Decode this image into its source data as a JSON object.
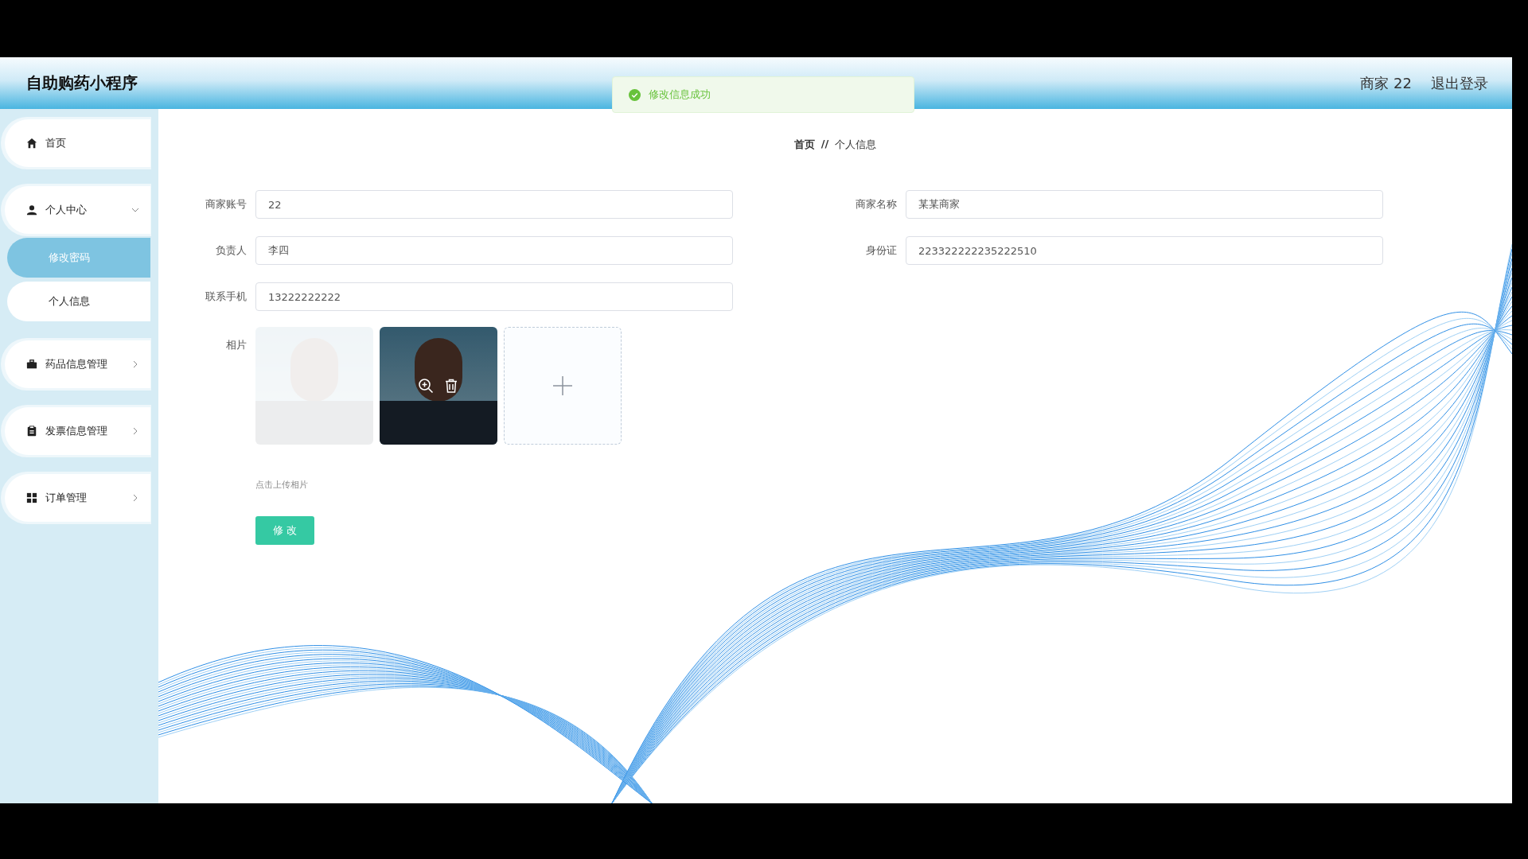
{
  "app": {
    "title": "自助购药小程序"
  },
  "header": {
    "user": "商家 22",
    "logout": "退出登录"
  },
  "toast": {
    "kind": "success",
    "message": "修改信息成功"
  },
  "sidebar": {
    "items": [
      {
        "label": "首页"
      },
      {
        "label": "个人中心",
        "expanded": true,
        "children": [
          {
            "label": "修改密码",
            "selected": true
          },
          {
            "label": "个人信息",
            "selected": false
          }
        ]
      },
      {
        "label": "药品信息管理",
        "expanded": false
      },
      {
        "label": "发票信息管理",
        "expanded": false
      },
      {
        "label": "订单管理",
        "expanded": false
      }
    ]
  },
  "breadcrumb": {
    "items": [
      "首页",
      "个人信息"
    ],
    "separator": "//"
  },
  "form": {
    "fields": [
      {
        "label": "商家账号",
        "value": "22"
      },
      {
        "label": "商家名称",
        "value": "某某商家"
      },
      {
        "label": "负责人",
        "value": "李四"
      },
      {
        "label": "身份证",
        "value": "223322222235222510"
      },
      {
        "label": "联系手机",
        "value": "13222222222"
      }
    ],
    "photo": {
      "label": "相片",
      "photos": [
        {
          "faded": true,
          "hovered": false
        },
        {
          "faded": false,
          "hovered": true
        }
      ],
      "hint": "点击上传相片"
    },
    "submit": "修 改"
  }
}
